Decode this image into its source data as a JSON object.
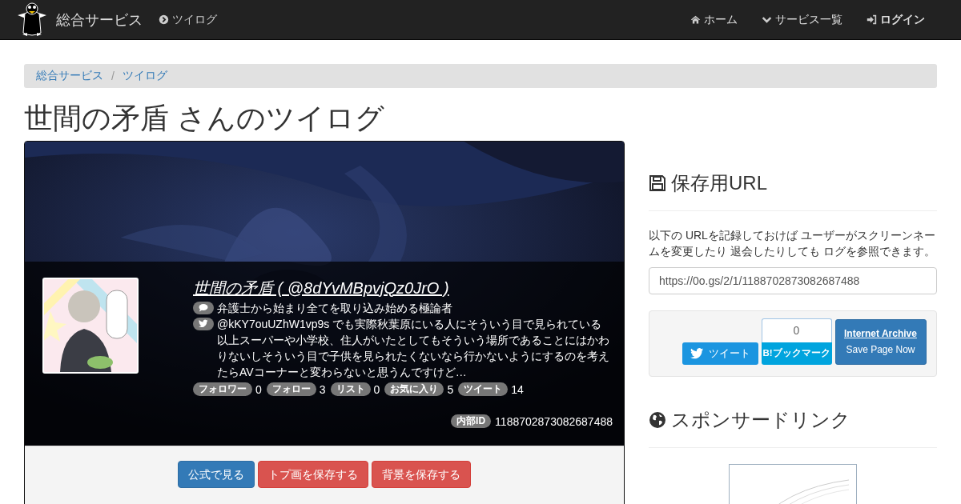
{
  "navbar": {
    "brand": "総合サービス",
    "links": [
      {
        "label": "ツイログ",
        "bold": false
      }
    ],
    "right_links": [
      {
        "label": "ホーム",
        "bold": false
      },
      {
        "label": "サービス一覧",
        "bold": false
      },
      {
        "label": "ログイン",
        "bold": true
      }
    ]
  },
  "breadcrumb": [
    "総合サービス",
    "ツイログ"
  ],
  "breadcrumb_separator": "/",
  "title": "世間の矛盾 さんのツイログ",
  "profile": {
    "name_link": "世間の矛盾 ( @8dYvMBpvjQz0JrO )",
    "bio": "弁護士から始まり全てを取り込み始める極論者",
    "tweet": "@kKY7ouUZhW1vp9s でも実際秋葉原にいる人にそういう目で見られている以上スーパーや小学校、住人がいたとしてもそういう場所であることにはかわりないしそういう目で子供を見られたくないなら行かないようにするのを考えたらAVコーナーと変わらないと思うんですけど…",
    "stats": [
      {
        "label": "フォロワー",
        "value": "0"
      },
      {
        "label": "フォロー",
        "value": "3"
      },
      {
        "label": "リスト",
        "value": "0"
      },
      {
        "label": "お気に入り",
        "value": "5"
      },
      {
        "label": "ツイート",
        "value": "14"
      }
    ],
    "internal_id": {
      "label": "内部ID",
      "value": "1188702873082687488"
    }
  },
  "actions": [
    {
      "label": "公式で見る",
      "kind": "primary"
    },
    {
      "label": "トプ画を保存する",
      "kind": "danger"
    },
    {
      "label": "背景を保存する",
      "kind": "danger"
    }
  ],
  "save_url": {
    "title": "保存用URL",
    "description": "以下の URLを記録しておけば ユーザーがスクリーンネームを変更したり 退会したりしても ログを参照できます。",
    "url": "https://0o.gs/2/1/1188702873082687488"
  },
  "share": {
    "tweet": "ツイート",
    "bookmark_count": "0",
    "bookmark": "B!ブックマーク",
    "archive_title": "Internet Archive",
    "archive_action": "Save Page Now"
  },
  "sponsored": {
    "title": "スポンサードリンク"
  }
}
